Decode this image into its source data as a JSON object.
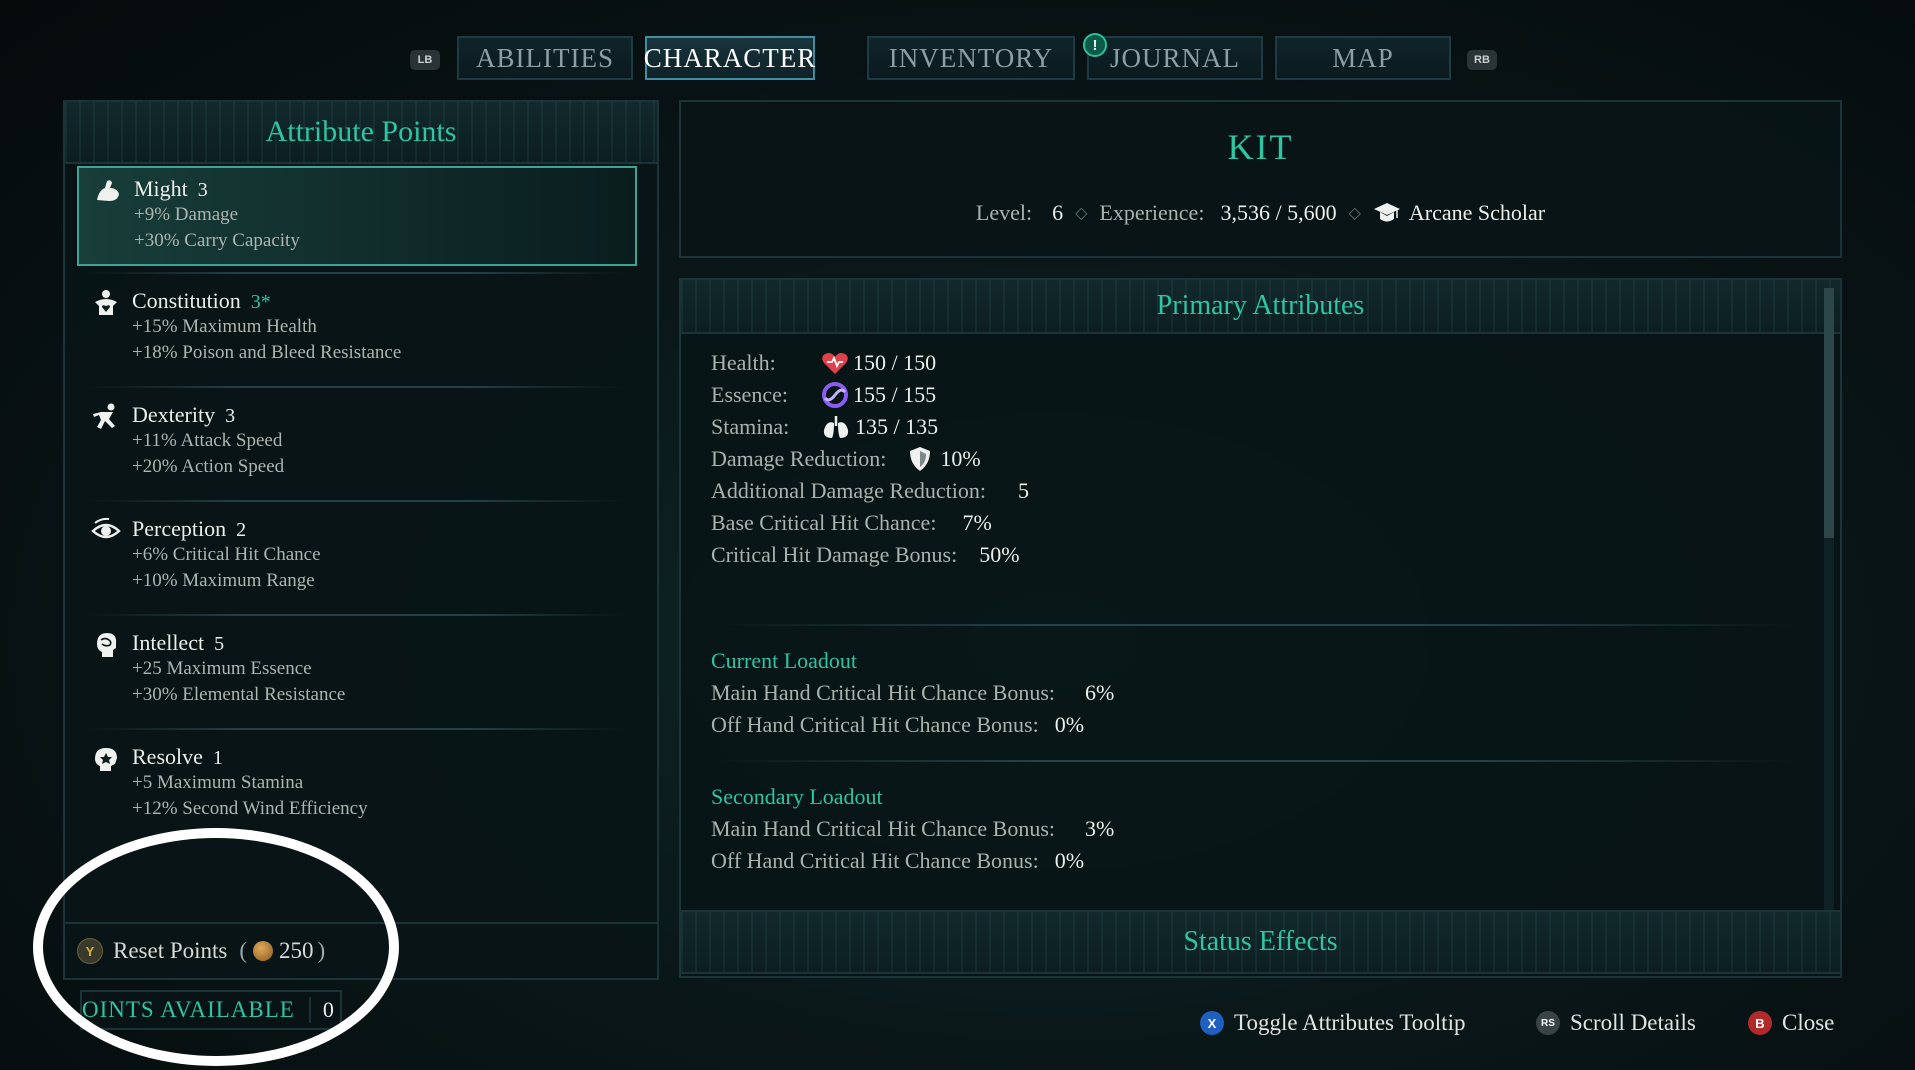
{
  "tabs": {
    "left_bumper": "LB",
    "right_bumper": "RB",
    "items": [
      {
        "label": "ABILITIES",
        "active": false
      },
      {
        "label": "CHARACTER",
        "active": true
      },
      {
        "label": "INVENTORY",
        "active": false
      },
      {
        "label": "JOURNAL",
        "active": false
      },
      {
        "label": "MAP",
        "active": false
      }
    ],
    "journal_notification": "!"
  },
  "attribute_panel": {
    "title": "Attribute Points",
    "items": [
      {
        "name": "Might",
        "value": "3",
        "effects": [
          "+9% Damage",
          "+30% Carry Capacity"
        ],
        "icon": "arm-flex-icon"
      },
      {
        "name": "Constitution",
        "value": "3*",
        "effects": [
          "+15% Maximum Health",
          "+18% Poison and Bleed Resistance"
        ],
        "icon": "heart-body-icon"
      },
      {
        "name": "Dexterity",
        "value": "3",
        "effects": [
          "+11% Attack Speed",
          "+20% Action Speed"
        ],
        "icon": "running-figure-icon"
      },
      {
        "name": "Perception",
        "value": "2",
        "effects": [
          "+6% Critical Hit Chance",
          "+10% Maximum Range"
        ],
        "icon": "eye-icon"
      },
      {
        "name": "Intellect",
        "value": "5",
        "effects": [
          "+25 Maximum Essence",
          "+30% Elemental Resistance"
        ],
        "icon": "brain-head-icon"
      },
      {
        "name": "Resolve",
        "value": "1",
        "effects": [
          "+5 Maximum Stamina",
          "+12% Second Wind Efficiency"
        ],
        "icon": "resolve-head-icon"
      }
    ],
    "reset": {
      "button": "Y",
      "label": "Reset Points",
      "cost": "250"
    },
    "points_available": {
      "label": "OINTS AVAILABLE",
      "value": "0"
    }
  },
  "character": {
    "name": "KIT",
    "level_label": "Level:",
    "level": "6",
    "experience_label": "Experience:",
    "experience": "3,536 / 5,600",
    "class": "Arcane Scholar"
  },
  "primary": {
    "title": "Primary Attributes",
    "health_label": "Health:",
    "health": "150 / 150",
    "essence_label": "Essence:",
    "essence": "155 / 155",
    "stamina_label": "Stamina:",
    "stamina": "135 / 135",
    "dr_label": "Damage Reduction:",
    "dr": "10%",
    "adr_label": "Additional Damage Reduction:",
    "adr": "5",
    "bchc_label": "Base Critical Hit Chance:",
    "bchc": "7%",
    "chdb_label": "Critical Hit Damage Bonus:",
    "chdb": "50%",
    "current_loadout": {
      "title": "Current Loadout",
      "main_label": "Main Hand Critical Hit Chance Bonus:",
      "main": "6%",
      "off_label": "Off Hand Critical Hit Chance Bonus:",
      "off": "0%"
    },
    "secondary_loadout": {
      "title": "Secondary Loadout",
      "main_label": "Main Hand Critical Hit Chance Bonus:",
      "main": "3%",
      "off_label": "Off Hand Critical Hit Chance Bonus:",
      "off": "0%"
    },
    "status_title": "Status Effects"
  },
  "hints": {
    "toggle": {
      "button": "X",
      "label": "Toggle Attributes Tooltip"
    },
    "scroll": {
      "button": "RS",
      "label": "Scroll Details"
    },
    "close": {
      "button": "B",
      "label": "Close"
    }
  },
  "colors": {
    "accent": "#2fc4a4",
    "health": "#e0404a",
    "essence": "#8a5cf0",
    "x_button": "#1f5fbf",
    "b_button": "#b02a2a",
    "y_button": "#c9a227"
  }
}
